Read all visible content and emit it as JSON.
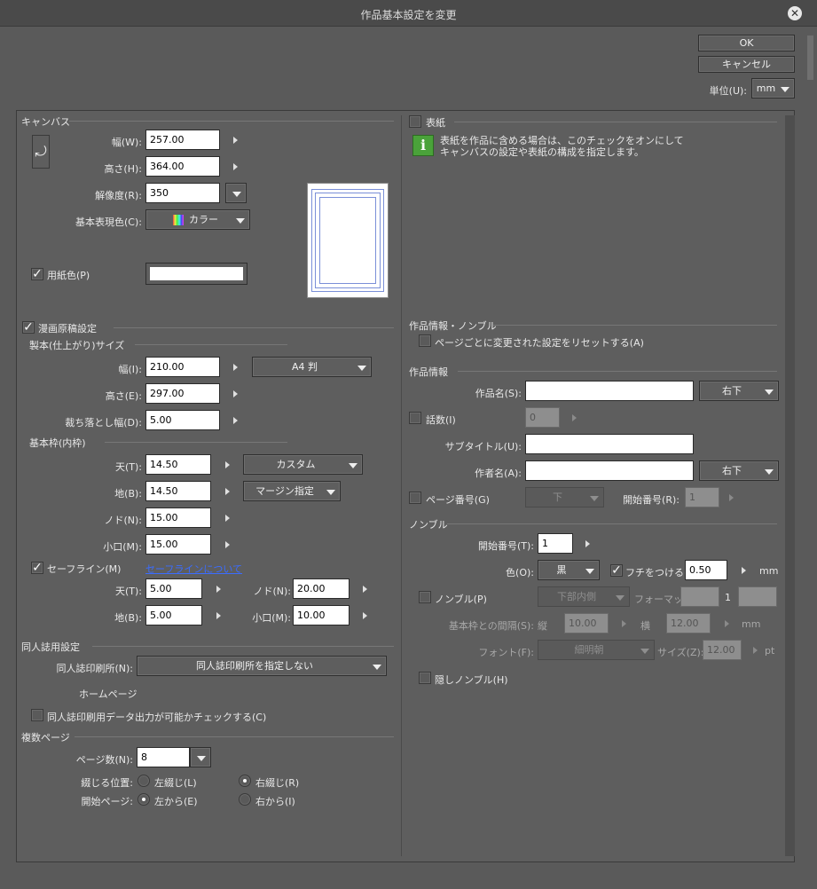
{
  "dialog": {
    "title": "作品基本設定を変更",
    "ok": "OK",
    "cancel": "キャンセル",
    "unit_label": "単位(U):",
    "unit_value": "mm"
  },
  "canvas": {
    "section": "キャンバス",
    "width_label": "幅(W):",
    "width": "257.00",
    "height_label": "高さ(H):",
    "height": "364.00",
    "resolution_label": "解像度(R):",
    "resolution": "350",
    "color_label": "基本表現色(C):",
    "color_value": "カラー",
    "paper_color_label": "用紙色(P)"
  },
  "manga": {
    "section": "漫画原稿設定",
    "finish_section": "製本(仕上がり)サイズ",
    "width_label": "幅(I):",
    "width": "210.00",
    "preset": "A4 判",
    "height_label": "高さ(E):",
    "height": "297.00",
    "bleed_label": "裁ち落とし幅(D):",
    "bleed": "5.00",
    "frame_section": "基本枠(内枠)",
    "top_label": "天(T):",
    "top": "14.50",
    "frame_preset": "カスタム",
    "bottom_label": "地(B):",
    "bottom": "14.50",
    "margin_preset": "マージン指定",
    "gutter_label": "ノド(N):",
    "gutter": "15.00",
    "fore_label": "小口(M):",
    "fore": "15.00",
    "safe_label": "セーフライン(M)",
    "safe_link": "セーフラインについて",
    "safe_top_label": "天(T):",
    "safe_top": "5.00",
    "safe_gutter_label": "ノド(N):",
    "safe_gutter": "20.00",
    "safe_bottom_label": "地(B):",
    "safe_bottom": "5.00",
    "safe_fore_label": "小口(M):",
    "safe_fore": "10.00"
  },
  "doujin": {
    "section": "同人誌用設定",
    "printer_label": "同人誌印刷所(N):",
    "printer_value": "同人誌印刷所を指定しない",
    "homepage": "ホームページ",
    "check_label": "同人誌印刷用データ出力が可能かチェックする(C)"
  },
  "pages": {
    "section": "複数ページ",
    "count_label": "ページ数(N):",
    "count": "8",
    "binding_label": "綴じる位置:",
    "left_bind": "左綴じ(L)",
    "right_bind": "右綴じ(R)",
    "start_label": "開始ページ:",
    "start_left": "左から(E)",
    "start_right": "右から(I)"
  },
  "cover": {
    "label": "表紙",
    "info": [
      "表紙を作品に含める場合は、このチェックをオンにして",
      "キャンバスの設定や表紙の構成を指定します。"
    ]
  },
  "work_nombre": {
    "section": "作品情報・ノンブル",
    "reset_label": "ページごとに変更された設定をリセットする(A)"
  },
  "work_info": {
    "section": "作品情報",
    "name_label": "作品名(S):",
    "name_pos": "右下",
    "episode_label": "話数(I)",
    "episode": "0",
    "subtitle_label": "サブタイトル(U):",
    "author_label": "作者名(A):",
    "author_pos": "右下",
    "page_num_label": "ページ番号(G)",
    "page_num_pos": "下",
    "start_num_label": "開始番号(R):",
    "start_num": "1"
  },
  "nombre": {
    "section": "ノンブル",
    "start_label": "開始番号(T):",
    "start": "1",
    "color_label": "色(O):",
    "color": "黒",
    "border_label": "フチをつける(E)",
    "border_width": "0.50",
    "unit": "mm",
    "nombre_label": "ノンブル(P)",
    "position": "下部内側",
    "format_label": "フォーマット:",
    "format_mid": "1",
    "gap_label": "基本枠との間隔(S):",
    "vert_label": "縦",
    "vert": "10.00",
    "horiz_label": "横",
    "horiz": "12.00",
    "gap_unit": "mm",
    "font_label": "フォント(F):",
    "font": "細明朝",
    "size_label": "サイズ(Z):",
    "size": "12.00",
    "size_unit": "pt",
    "hidden_label": "隠しノンブル(H)"
  }
}
